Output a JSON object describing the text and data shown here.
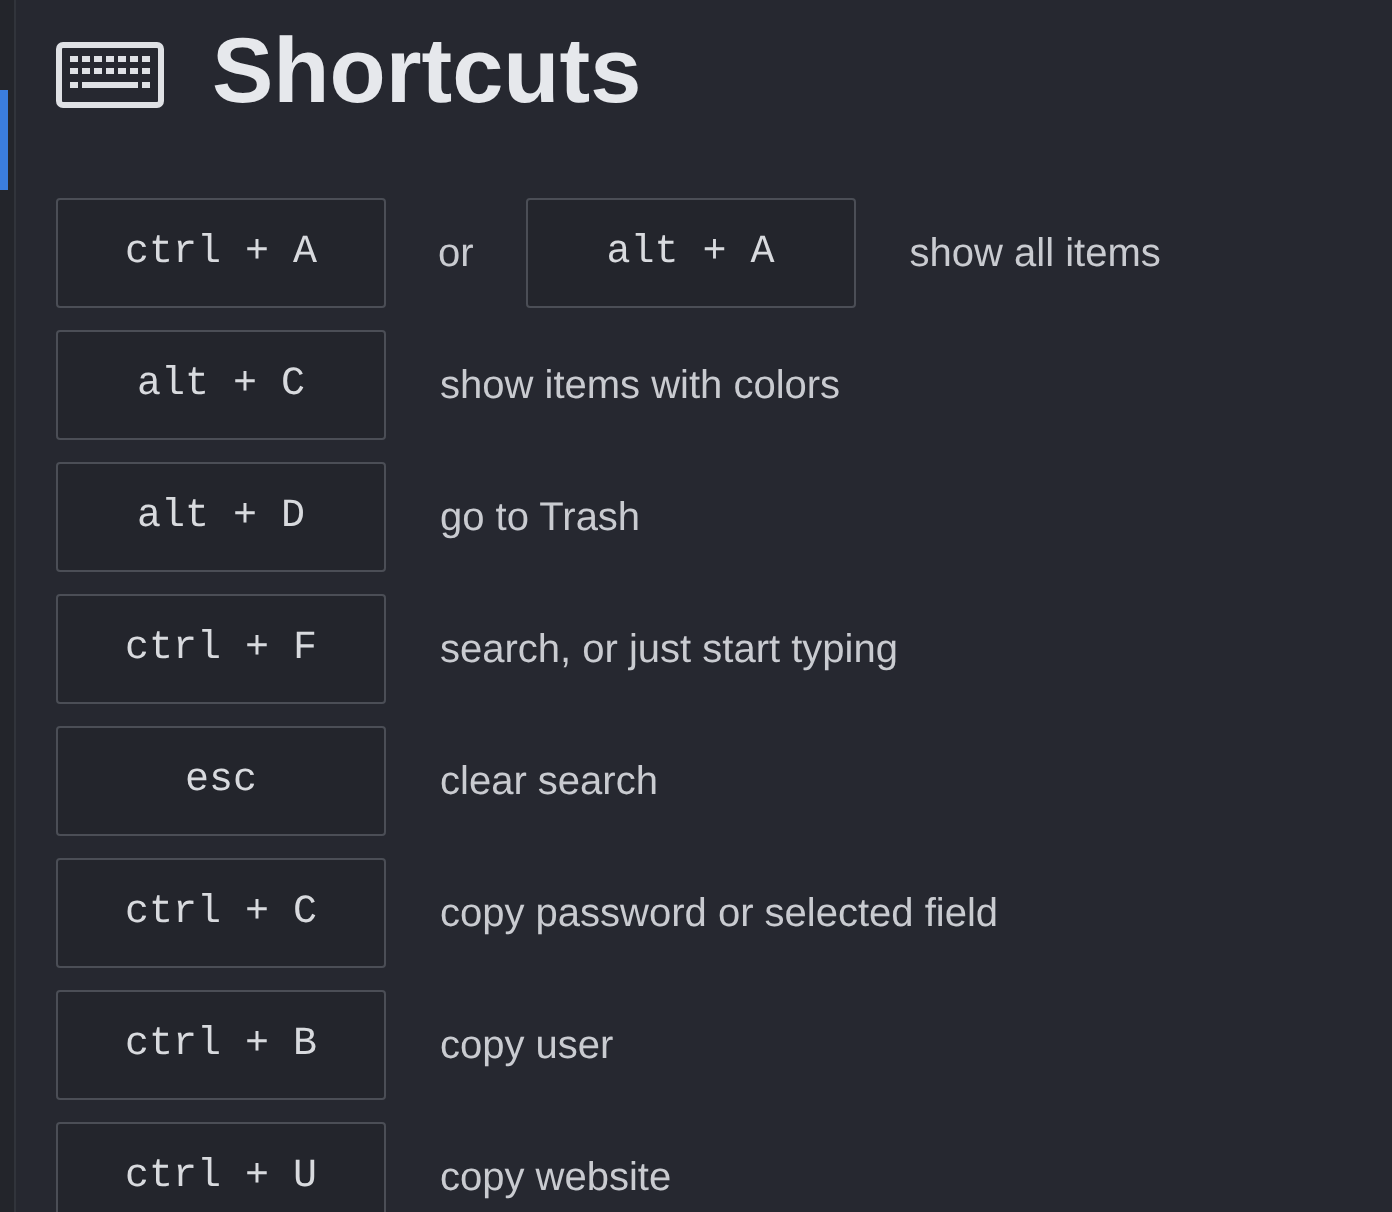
{
  "title": "Shortcuts",
  "shortcuts": [
    {
      "parts": [
        {
          "kind": "key",
          "text": "ctrl + A"
        },
        {
          "kind": "text",
          "text": "or"
        },
        {
          "kind": "key",
          "text": "alt + A"
        },
        {
          "kind": "text",
          "text": "show all items"
        }
      ]
    },
    {
      "parts": [
        {
          "kind": "key",
          "text": "alt + C"
        },
        {
          "kind": "text",
          "text": "show items with colors"
        }
      ]
    },
    {
      "parts": [
        {
          "kind": "key",
          "text": "alt + D"
        },
        {
          "kind": "text",
          "text": "go to Trash"
        }
      ]
    },
    {
      "parts": [
        {
          "kind": "key",
          "text": "ctrl + F"
        },
        {
          "kind": "text",
          "text": "search, or just start typing"
        }
      ]
    },
    {
      "parts": [
        {
          "kind": "key",
          "text": "esc"
        },
        {
          "kind": "text",
          "text": "clear search"
        }
      ]
    },
    {
      "parts": [
        {
          "kind": "key",
          "text": "ctrl + C"
        },
        {
          "kind": "text",
          "text": "copy password or selected field"
        }
      ]
    },
    {
      "parts": [
        {
          "kind": "key",
          "text": "ctrl + B"
        },
        {
          "kind": "text",
          "text": "copy user"
        }
      ]
    },
    {
      "parts": [
        {
          "kind": "key",
          "text": "ctrl + U"
        },
        {
          "kind": "text",
          "text": "copy website"
        }
      ]
    }
  ]
}
